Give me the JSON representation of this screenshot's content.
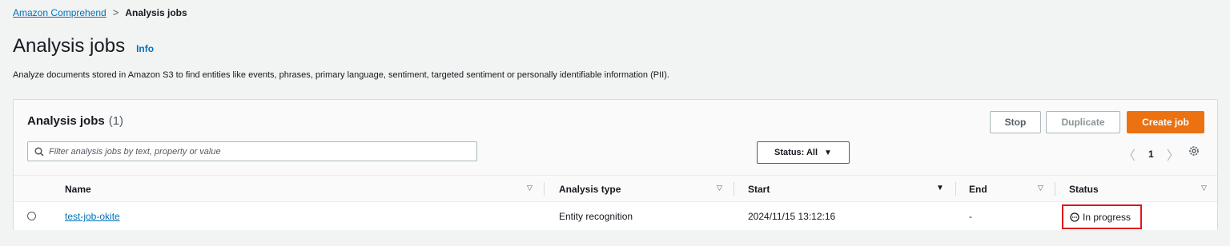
{
  "breadcrumb": {
    "root": "Amazon Comprehend",
    "separator": ">",
    "current": "Analysis jobs"
  },
  "header": {
    "title": "Analysis jobs",
    "info": "Info",
    "description": "Analyze documents stored in Amazon S3 to find entities like events, phrases, primary language, sentiment, targeted sentiment or personally identifiable information (PII)."
  },
  "panel": {
    "title": "Analysis jobs",
    "count": "(1)",
    "buttons": {
      "stop": "Stop",
      "duplicate": "Duplicate",
      "create": "Create job"
    },
    "search_placeholder": "Filter analysis jobs by text, property or value",
    "status_filter": "Status: All",
    "page": "1"
  },
  "table": {
    "columns": [
      "Name",
      "Analysis type",
      "Start",
      "End",
      "Status"
    ],
    "rows": [
      {
        "name": "test-job-okite",
        "type": "Entity recognition",
        "start": "2024/11/15 13:12:16",
        "end": "-",
        "status": "In progress"
      }
    ]
  },
  "colors": {
    "link": "#0073bb",
    "primary": "#ec7211",
    "highlight": "#e0151b"
  }
}
